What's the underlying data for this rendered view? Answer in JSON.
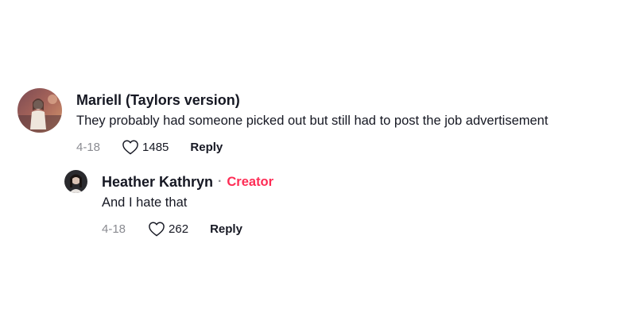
{
  "comments": [
    {
      "author": "Mariell (Taylors version)",
      "text": "They probably had someone picked out but still had to post the job advertisement",
      "date": "4-18",
      "likes": "1485",
      "reply_label": "Reply",
      "avatar_icon": "user-photo-avatar"
    },
    {
      "author": "Heather Kathryn",
      "separator": "·",
      "badge": "Creator",
      "text": "And I hate that",
      "date": "4-18",
      "likes": "262",
      "reply_label": "Reply",
      "avatar_icon": "user-photo-avatar"
    }
  ],
  "colors": {
    "text": "#161823",
    "muted": "#8a8b91",
    "creator_badge": "#fe2c55",
    "background": "#ffffff"
  },
  "icons": {
    "like": "heart-outline-icon"
  }
}
